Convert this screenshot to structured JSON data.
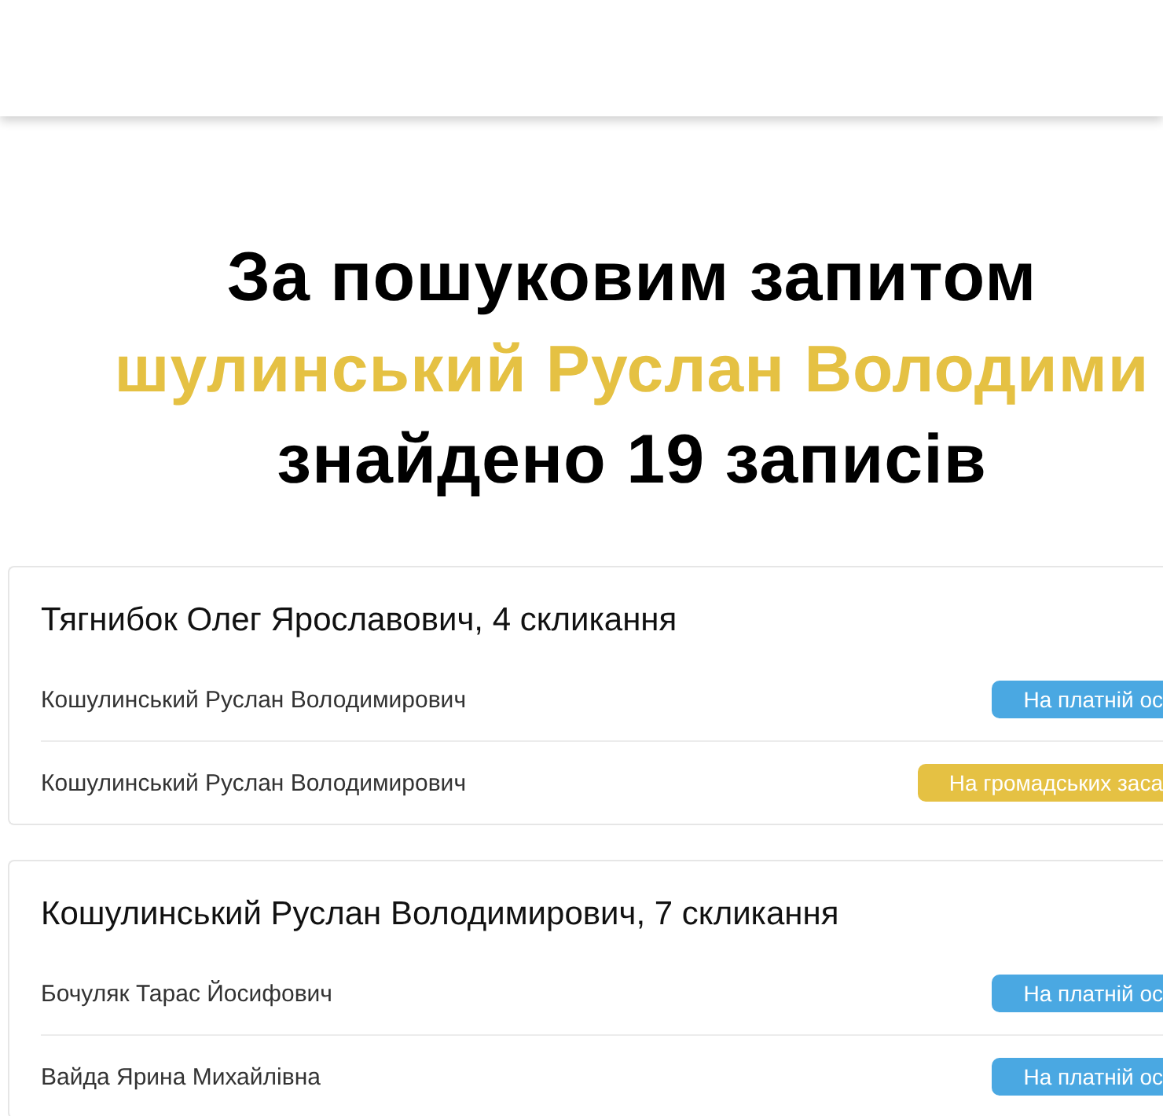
{
  "heading": {
    "line_1": "За пошуковим запитом",
    "query": "шулинський Руслан Володими",
    "line_3": "знайдено 19 записів"
  },
  "results": [
    {
      "title": "Тягнибок Олег Ярославович, 4 скликання",
      "rows": [
        {
          "name": "Кошулинський Руслан Володимирович",
          "badge": "На платній ос",
          "color": "#4aa8e2"
        },
        {
          "name": "Кошулинський Руслан Володимирович",
          "badge": "На громадських заса",
          "color": "#e5c143"
        }
      ]
    },
    {
      "title": "Кошулинський Руслан Володимирович, 7 скликання",
      "rows": [
        {
          "name": "Бочуляк Тарас Йосифович",
          "badge": "На платній ос",
          "color": "#4aa8e2"
        },
        {
          "name": "Вайда Ярина Михайлівна",
          "badge": "На платній ос",
          "color": "#4aa8e2"
        }
      ]
    }
  ]
}
